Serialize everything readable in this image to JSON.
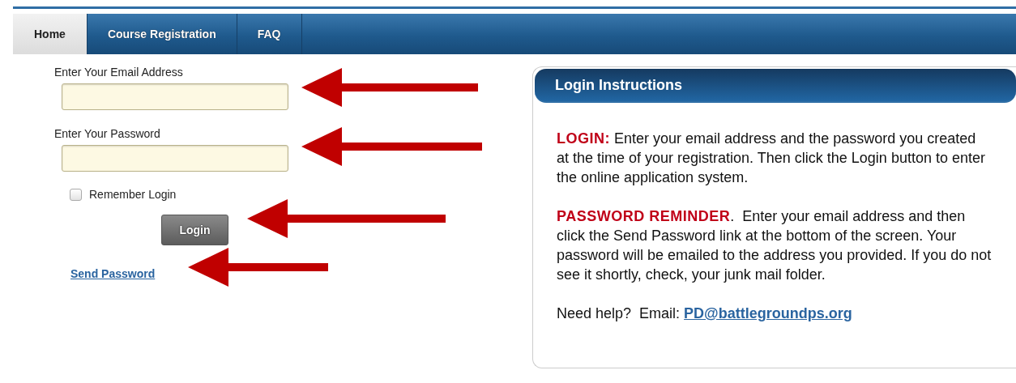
{
  "tabs": [
    {
      "label": "Home",
      "selected": true
    },
    {
      "label": "Course Registration",
      "selected": false
    },
    {
      "label": "FAQ",
      "selected": false
    }
  ],
  "login_form": {
    "email_label": "Enter Your Email Address",
    "password_label": "Enter Your Password",
    "remember": {
      "label": "Remember Login",
      "checked": false
    },
    "login_button": "Login",
    "send_password_link": "Send Password"
  },
  "instructions": {
    "title": "Login Instructions",
    "paragraphs": [
      "**LOGIN:** Enter your email address and the password you created at the time of your registration. Then click the Login button to enter the online application system.",
      "**PASSWORD REMINDER**.  Enter your email address and then click the Send Password link at the bottom of the screen. Your password will be emailed to the address you provided. If you do not see it shortly, check, your junk mail folder."
    ],
    "help_text": "Need help?  Email: ",
    "help_email": "PD@battlegroundps.org"
  }
}
